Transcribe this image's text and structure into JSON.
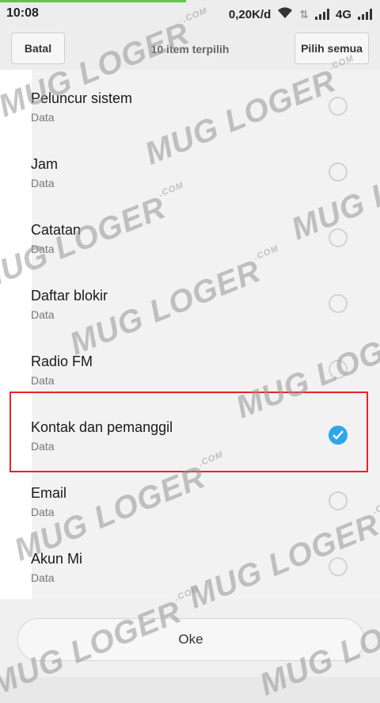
{
  "status_bar": {
    "time": "10:08",
    "speed": "0,20K/d",
    "network": "4G"
  },
  "header": {
    "cancel_label": "Batal",
    "title": "10 item terpilih",
    "select_all_label": "Pilih semua"
  },
  "list": {
    "items": [
      {
        "title": "Peluncur sistem",
        "subtitle": "Data",
        "checked": false
      },
      {
        "title": "Jam",
        "subtitle": "Data",
        "checked": false
      },
      {
        "title": "Catatan",
        "subtitle": "Data",
        "checked": false
      },
      {
        "title": "Daftar blokir",
        "subtitle": "Data",
        "checked": false
      },
      {
        "title": "Radio FM",
        "subtitle": "Data",
        "checked": false
      },
      {
        "title": "Kontak dan pemanggil",
        "subtitle": "Data",
        "checked": true
      },
      {
        "title": "Email",
        "subtitle": "Data",
        "checked": false
      },
      {
        "title": "Akun Mi",
        "subtitle": "Data",
        "checked": false
      }
    ]
  },
  "footer": {
    "ok_label": "Oke"
  },
  "watermark": {
    "text": "MUG LOGER",
    "suffix": ".COM"
  },
  "colors": {
    "accent": "#2fa6ea",
    "highlight": "#e8232a",
    "progress": "#62c547"
  }
}
